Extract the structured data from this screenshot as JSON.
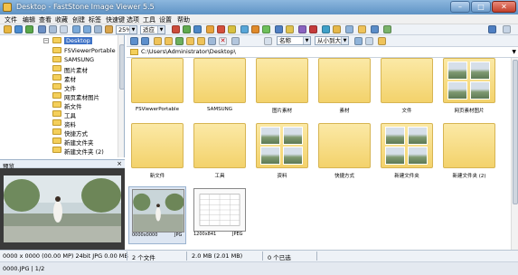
{
  "window": {
    "title": "Desktop - FastStone Image Viewer 5.5",
    "buttons": {
      "minimize": "–",
      "maximize": "□",
      "close": "✕"
    }
  },
  "menu": [
    "文件",
    "编辑",
    "查看",
    "收藏",
    "创建",
    "标签",
    "快速键",
    "选项",
    "工具",
    "设置",
    "帮助"
  ],
  "toolbar": {
    "zoom": "25%",
    "fit": "适应",
    "sort_field": "名称",
    "sort_order": "从小到大"
  },
  "tree": {
    "items": [
      {
        "label": "Desktop",
        "selected": true
      },
      {
        "label": "FSViewerPortable"
      },
      {
        "label": "SAMSUNG"
      },
      {
        "label": "图片素材"
      },
      {
        "label": "素材"
      },
      {
        "label": "文件"
      },
      {
        "label": "网页素材图片"
      },
      {
        "label": "新文件"
      },
      {
        "label": "工具"
      },
      {
        "label": "资料"
      },
      {
        "label": "快捷方式"
      },
      {
        "label": "新建文件夹"
      },
      {
        "label": "新建文件夹 (2)"
      }
    ]
  },
  "preview": {
    "title": "预览",
    "close": "×"
  },
  "path": {
    "text": "C:\\Users\\Administrator\\Desktop\\"
  },
  "thumbnails": [
    {
      "caption": "FSViewerPortable",
      "type": "folder"
    },
    {
      "caption": "SAMSUNG",
      "type": "folder"
    },
    {
      "caption": "图片素材",
      "type": "folder"
    },
    {
      "caption": "素材",
      "type": "folder"
    },
    {
      "caption": "文件",
      "type": "folder"
    },
    {
      "caption": "网页素材图片",
      "type": "folder-photos"
    },
    {
      "caption": "新文件",
      "type": "folder"
    },
    {
      "caption": "工具",
      "type": "folder"
    },
    {
      "caption": "资料",
      "type": "folder-photos"
    },
    {
      "caption": "快捷方式",
      "type": "folder"
    },
    {
      "caption": "新建文件夹",
      "type": "folder-photos"
    },
    {
      "caption": "新建文件夹 (2)",
      "type": "folder"
    },
    {
      "caption": "",
      "type": "photo",
      "meta_left": "0000x0000",
      "meta_right": "JPG"
    },
    {
      "caption": "",
      "type": "document",
      "meta_left": "1200x841",
      "meta_right": "JPEG"
    }
  ],
  "status1": [
    "0000 x 0000 (00.00 MP) 24bit JPG 0.00 MB",
    "2 个文件",
    "2.0 MB (2.01 MB)",
    "0 个已选"
  ],
  "status2": "0000.JPG | 1/2",
  "colors": {
    "folder": "#f3d26b",
    "selection": "#3f73c7",
    "titlebar": "#6b9fd0"
  }
}
